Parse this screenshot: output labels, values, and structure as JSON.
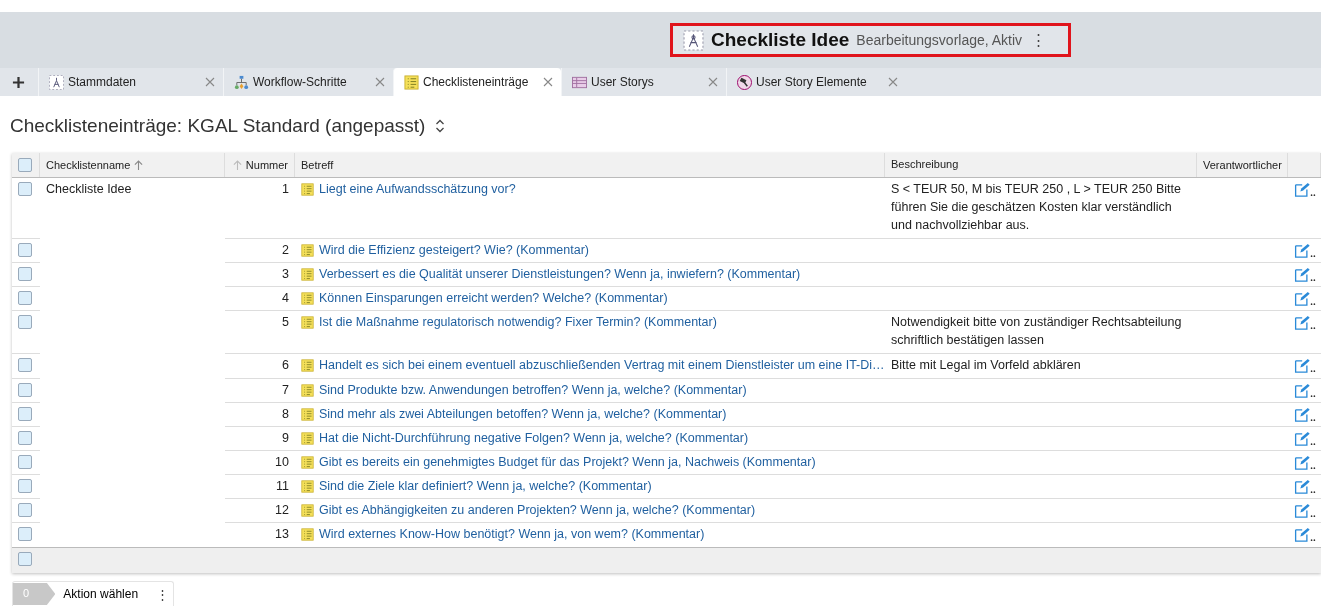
{
  "header": {
    "title": "Checkliste Idee",
    "subtitle": "Bearbeitungsvorlage, Aktiv",
    "menu": "⋮"
  },
  "tabs": [
    {
      "label": "Stammdaten",
      "kind": "compass",
      "selected": false
    },
    {
      "label": "Workflow-Schritte",
      "kind": "workflow",
      "selected": false
    },
    {
      "label": "Checklisteneinträge",
      "kind": "checklist",
      "selected": true
    },
    {
      "label": "User Storys",
      "kind": "story",
      "selected": false
    },
    {
      "label": "User Story Elemente",
      "kind": "element",
      "selected": false
    }
  ],
  "page_title": "Checklisteneinträge: KGAL Standard (angepasst)",
  "table": {
    "columns": [
      "Checklistenname",
      "Nummer",
      "Betreff",
      "Beschreibung",
      "Verantwortlicher"
    ],
    "header_checked": false,
    "group_name": "Checkliste Idee",
    "rows": [
      {
        "number": "1",
        "subject": "Liegt eine Aufwandsschätzung vor?",
        "description": "S < TEUR 50, M bis TEUR 250 , L > TEUR 250 Bitte führen Sie die geschätzen Kosten klar verständlich und nachvollziehbar aus.",
        "checked": false
      },
      {
        "number": "2",
        "subject": "Wird die Effizienz gesteigert? Wie? (Kommentar)",
        "checked": false
      },
      {
        "number": "3",
        "subject": "Verbessert es die Qualität unserer Dienstleistungen? Wenn ja, inwiefern? (Kommentar)",
        "checked": false
      },
      {
        "number": "4",
        "subject": "Können Einsparungen erreicht werden? Welche? (Kommentar)",
        "checked": false
      },
      {
        "number": "5",
        "subject": "Ist die Maßnahme regulatorisch notwendig? Fixer Termin? (Kommentar)",
        "description": "Notwendigkeit bitte von zuständiger Rechtsabteilung schriftlich bestätigen lassen",
        "checked": false
      },
      {
        "number": "6",
        "subject": "Handelt es sich bei einem eventuell abzuschließenden Vertrag mit einem Dienstleister um eine IT-Di…",
        "description": "Bitte mit Legal im Vorfeld abklären",
        "checked": false
      },
      {
        "number": "7",
        "subject": "Sind Produkte bzw. Anwendungen betroffen? Wenn ja, welche? (Kommentar)",
        "checked": false
      },
      {
        "number": "8",
        "subject": "Sind mehr als zwei Abteilungen betoffen? Wenn ja, welche? (Kommentar)",
        "checked": false
      },
      {
        "number": "9",
        "subject": "Hat die Nicht-Durchführung negative Folgen? Wenn ja, welche? (Kommentar)",
        "checked": false
      },
      {
        "number": "10",
        "subject": "Gibt es bereits ein genehmigtes Budget für das Projekt? Wenn ja, Nachweis (Kommentar)",
        "checked": false
      },
      {
        "number": "11",
        "subject": "Sind die Ziele klar definiert? Wenn ja, welche? (Kommentar)",
        "checked": false
      },
      {
        "number": "12",
        "subject": "Gibt es Abhängigkeiten zu anderen Projekten? Wenn ja, welche? (Kommentar)",
        "checked": false
      },
      {
        "number": "13",
        "subject": "Wird externes Know-How benötigt? Wenn ja, von wem? (Kommentar)",
        "checked": false
      }
    ],
    "footer_checked": false
  },
  "action_bar": {
    "count": "0",
    "label": "Aktion wählen",
    "menu": "⋮"
  }
}
